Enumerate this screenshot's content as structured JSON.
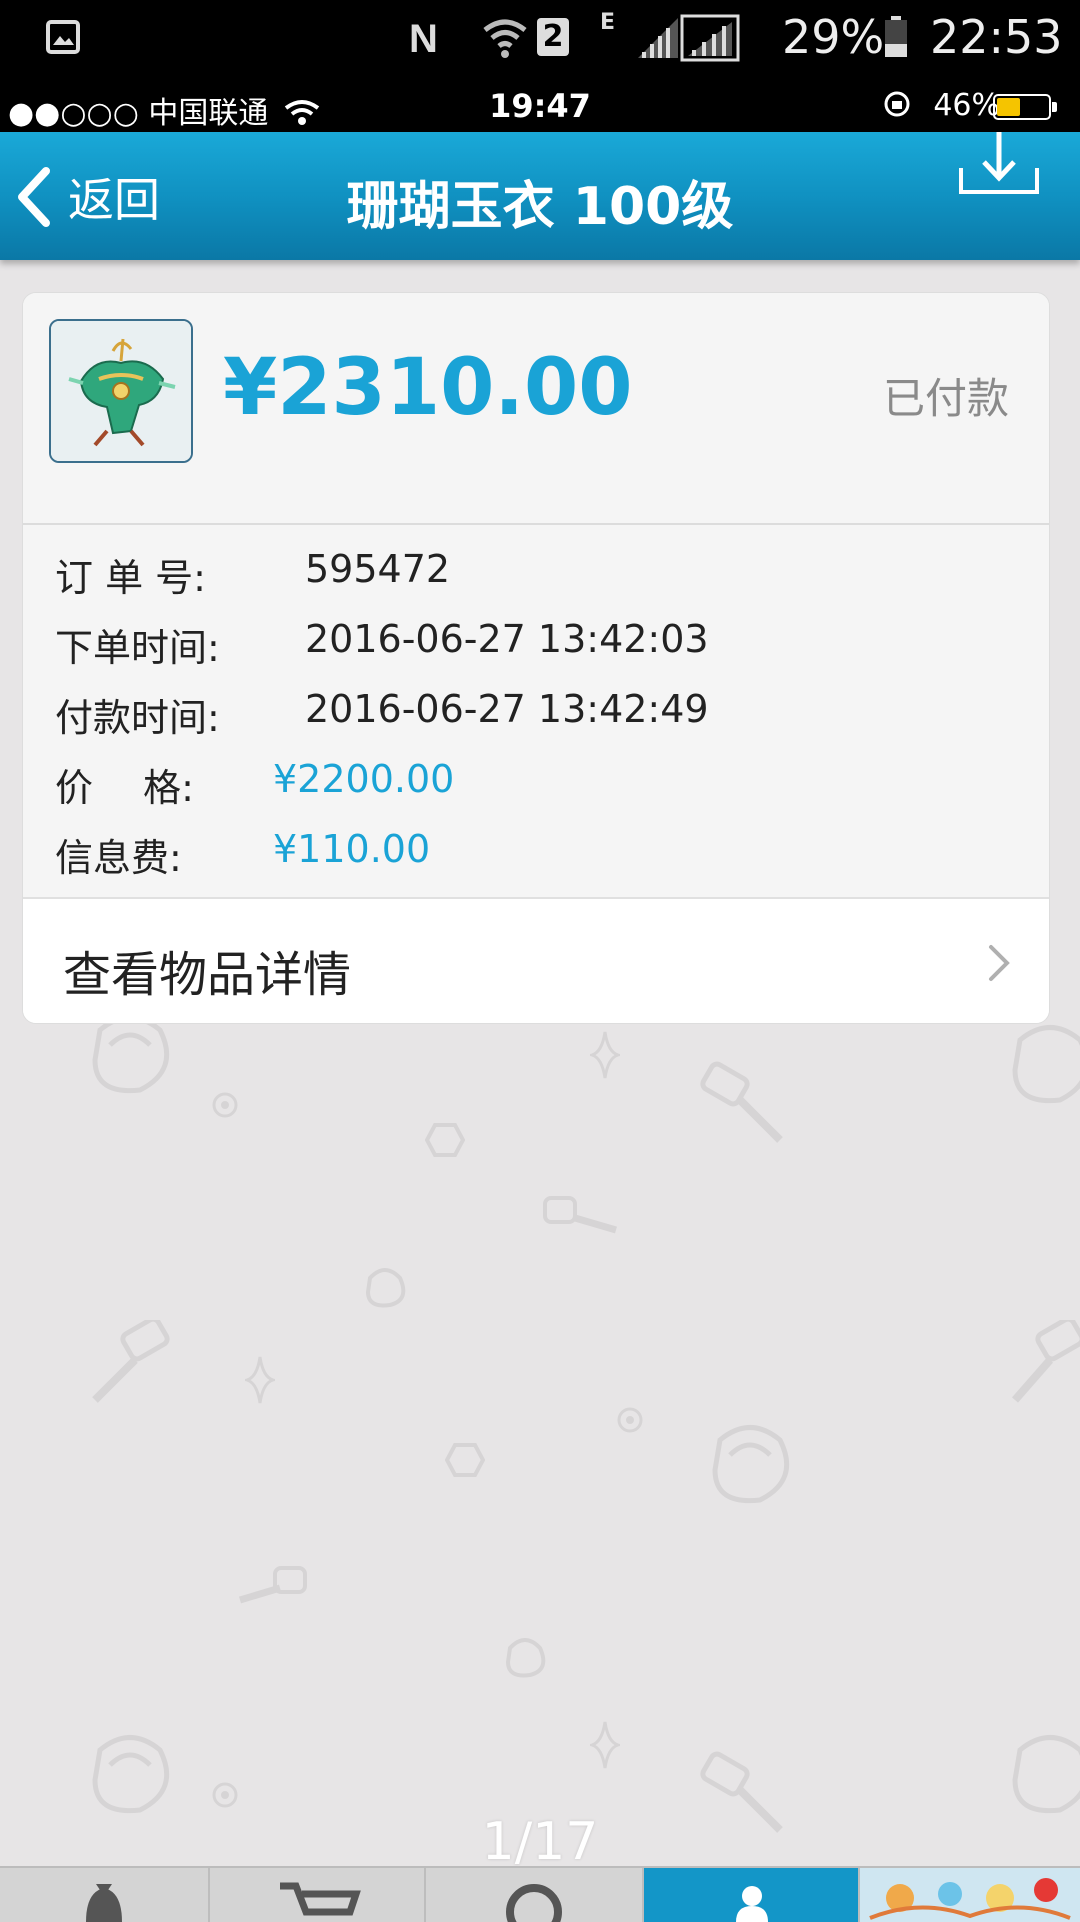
{
  "outer_status": {
    "battery_percent": "29%",
    "time": "22:53",
    "network_label": "E",
    "sim_badge": "2",
    "icons": [
      "gallery-icon",
      "nfc-icon",
      "wifi-icon",
      "sim-2-icon",
      "signal-icon",
      "signal-icon",
      "battery-icon"
    ]
  },
  "ios_status": {
    "carrier": "●●○○○ 中国联通",
    "time": "19:47",
    "battery_percent": "46%",
    "battery_level": 0.46
  },
  "nav": {
    "back_label": "返回",
    "title": "珊瑚玉衣 100级",
    "download_icon": "download-icon"
  },
  "order": {
    "total": "¥2310.00",
    "status": "已付款",
    "thumbnail_icon": "item-thumbnail-icon",
    "fields": [
      {
        "label": "订 单 号:",
        "value": "595472"
      },
      {
        "label": "下单时间:",
        "value": "2016-06-27 13:42:03"
      },
      {
        "label": "付款时间:",
        "value": "2016-06-27 13:42:49"
      },
      {
        "label": "价　 格:",
        "value": "¥2200.00"
      },
      {
        "label": "信息费:",
        "value": "¥110.00"
      }
    ],
    "view_detail_label": "查看物品详情"
  },
  "page_indicator": "1/17",
  "tabs": [
    {
      "icon": "money-bag-icon"
    },
    {
      "icon": "cart-icon"
    },
    {
      "icon": "search-icon"
    },
    {
      "icon": "user-icon",
      "active": true
    },
    {
      "icon": "game-banner-icon"
    }
  ],
  "colors": {
    "accent": "#1aa3d6",
    "nav_bar": "#0f8fbf",
    "status_gray": "#8a8a8a",
    "background": "#e7e5e6"
  }
}
